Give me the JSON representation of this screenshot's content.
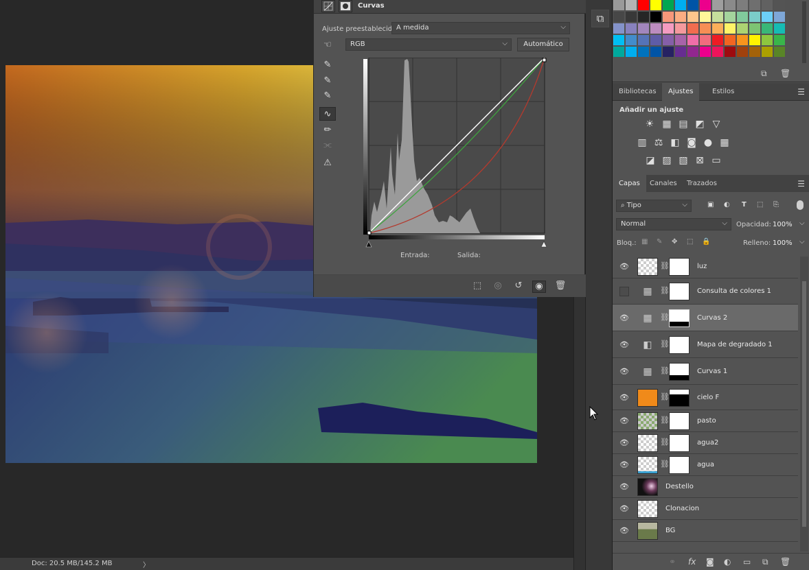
{
  "status": {
    "doc": "Doc: 20.5 MB/145.2 MB",
    "arrow": "〉"
  },
  "properties": {
    "title": "Curvas",
    "preset_label": "Ajuste preestablecido:",
    "preset_value": "A medida",
    "channel_value": "RGB",
    "auto_label": "Automático",
    "input_label": "Entrada:",
    "output_label": "Salida:"
  },
  "panels": {
    "tabs1": [
      "Bibliotecas",
      "Ajustes",
      "Estilos"
    ],
    "adjust_title": "Añadir un ajuste",
    "tabs2": [
      "Capas",
      "Canales",
      "Trazados"
    ]
  },
  "layers_panel": {
    "filter_value": "Tipo",
    "blend_value": "Normal",
    "opacity_label": "Opacidad:",
    "opacity_value": "100%",
    "lock_label": "Bloq.:",
    "fill_label": "Relleno:",
    "fill_value": "100%",
    "layers": [
      {
        "name": "luz",
        "visible": true
      },
      {
        "name": "Consulta de colores 1",
        "visible": false
      },
      {
        "name": "Curvas 2",
        "visible": true,
        "selected": true
      },
      {
        "name": "Mapa de degradado 1",
        "visible": true
      },
      {
        "name": "Curvas 1",
        "visible": true
      },
      {
        "name": "cielo F",
        "visible": true
      },
      {
        "name": "pasto",
        "visible": true
      },
      {
        "name": "agua2",
        "visible": true
      },
      {
        "name": "agua",
        "visible": true
      },
      {
        "name": "Destello",
        "visible": true
      },
      {
        "name": "Clonacion",
        "visible": true
      },
      {
        "name": "BG",
        "visible": true
      }
    ]
  },
  "swatch_colors": [
    "#9a9a9a",
    "#b4b4b4",
    "#ff0000",
    "#ffff00",
    "#00a651",
    "#00aeef",
    "#0054a6",
    "#ec008c",
    "#9e9e9e",
    "#8a8a8a",
    "#7d7d7d",
    "#6f6f6f",
    "#616161",
    "#545454",
    "#474747",
    "#383838",
    "#262626",
    "#000000",
    "#f7977a",
    "#fbad82",
    "#fdc68c",
    "#fff799",
    "#c6df9c",
    "#a4d49d",
    "#81ca9d",
    "#7bcdc9",
    "#6ccff7",
    "#7ea7d8",
    "#8493ca",
    "#8881be",
    "#a286bd",
    "#bc8cbf",
    "#f49bc1",
    "#f5999d",
    "#f26c4f",
    "#f68e55",
    "#fbaf5a",
    "#fff467",
    "#acd372",
    "#7dc473",
    "#39b778",
    "#16bcb4",
    "#00bff3",
    "#438ccb",
    "#5573b7",
    "#5e5ca7",
    "#855fa8",
    "#a763a9",
    "#ef6ea8",
    "#f16d7e",
    "#ed1c24",
    "#f26522",
    "#f7941d",
    "#fff200",
    "#8dc63f",
    "#39b54a",
    "#00a99d",
    "#00aeef",
    "#0072bc",
    "#0054a6",
    "#262262",
    "#662d91",
    "#92278f",
    "#ec008c",
    "#ed145b",
    "#9e0b0f",
    "#a0410d",
    "#a36209",
    "#aba000",
    "#598527"
  ]
}
